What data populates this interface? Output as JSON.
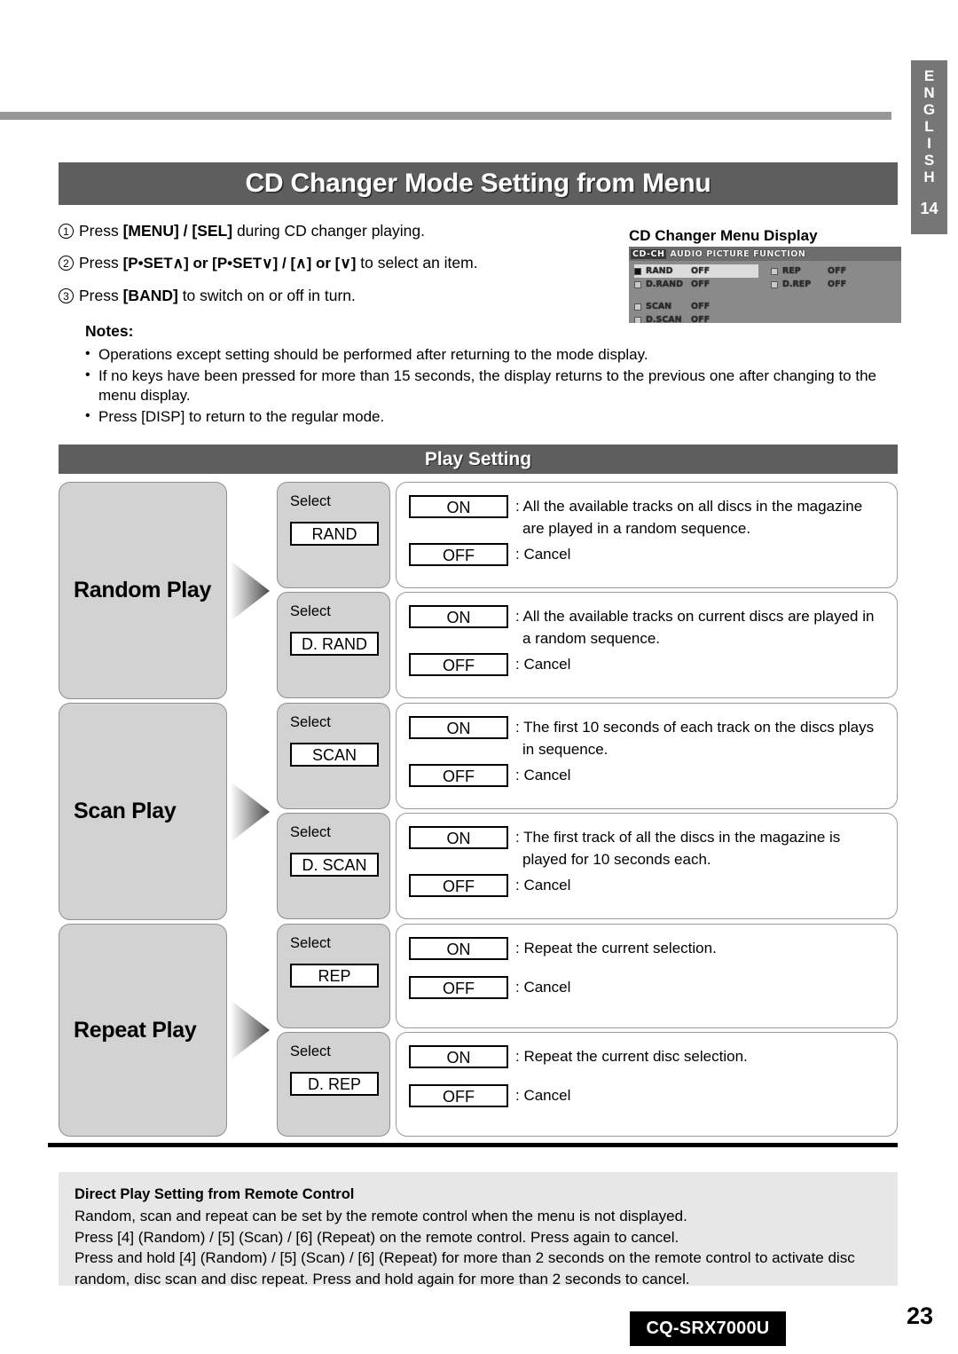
{
  "lang_tab": {
    "letters": [
      "E",
      "N",
      "G",
      "L",
      "I",
      "S",
      "H"
    ],
    "section_number": "14"
  },
  "header": {
    "title": "CD Changer Mode Setting from Menu"
  },
  "steps": [
    {
      "num": "1",
      "prefix": "Press ",
      "key1": "[MENU] / [SEL]",
      "suffix": " during CD changer playing."
    },
    {
      "num": "2",
      "prefix": "Press ",
      "key1": "[P•SET∧] or [P•SET∨] / [∧] or [∨]",
      "suffix": " to select an item."
    },
    {
      "num": "3",
      "prefix": "Press ",
      "key1": "[BAND]",
      "suffix": " to switch on or off in turn."
    }
  ],
  "notes": {
    "heading": "Notes:",
    "items": [
      "Operations except setting should be performed after returning to the mode display.",
      "If no keys have been pressed for more than 15 seconds, the display returns to the previous one after changing to the menu display.",
      "Press [DISP] to return to the regular mode."
    ]
  },
  "lcd": {
    "caption": "CD Changer Menu Display",
    "tabs": [
      "CD-CH",
      "AUDIO",
      "PICTURE",
      "FUNCTION"
    ],
    "selected_tab": "CD-CH",
    "left_items": [
      {
        "label": "RAND",
        "value": "OFF",
        "highlighted": true
      },
      {
        "label": "D.RAND",
        "value": "OFF",
        "highlighted": false
      }
    ],
    "right_items": [
      {
        "label": "REP",
        "value": "OFF",
        "highlighted": false
      },
      {
        "label": "D.REP",
        "value": "OFF",
        "highlighted": false
      }
    ],
    "bottom_items": [
      {
        "label": "SCAN",
        "value": "OFF",
        "highlighted": false
      },
      {
        "label": "D.SCAN",
        "value": "OFF",
        "highlighted": false
      }
    ]
  },
  "play_setting": {
    "title": "Play Setting"
  },
  "groups": [
    {
      "category": "Random Play",
      "rows": [
        {
          "select_label": "Select",
          "code": "RAND",
          "on_label": "ON",
          "on_desc": ": All the available tracks on all discs in the magazine",
          "on_desc_cont": "are played in a random sequence.",
          "off_label": "OFF",
          "off_desc": ": Cancel"
        },
        {
          "select_label": "Select",
          "code": "D. RAND",
          "on_label": "ON",
          "on_desc": ": All the available tracks on current discs are played in",
          "on_desc_cont": "a random sequence.",
          "off_label": "OFF",
          "off_desc": ": Cancel"
        }
      ]
    },
    {
      "category": "Scan Play",
      "rows": [
        {
          "select_label": "Select",
          "code": "SCAN",
          "on_label": "ON",
          "on_desc": ": The first 10 seconds of each track on the discs plays",
          "on_desc_cont": "in sequence.",
          "off_label": "OFF",
          "off_desc": ": Cancel"
        },
        {
          "select_label": "Select",
          "code": "D. SCAN",
          "on_label": "ON",
          "on_desc": ": The first track of all the discs in the magazine is",
          "on_desc_cont": "played for 10 seconds each.",
          "off_label": "OFF",
          "off_desc": ": Cancel"
        }
      ]
    },
    {
      "category": "Repeat Play",
      "rows": [
        {
          "select_label": "Select",
          "code": "REP",
          "on_label": "ON",
          "on_desc": ": Repeat the current selection.",
          "on_desc_cont": "",
          "off_label": "OFF",
          "off_desc": ": Cancel"
        },
        {
          "select_label": "Select",
          "code": "D. REP",
          "on_label": "ON",
          "on_desc": ": Repeat the current disc selection.",
          "on_desc_cont": "",
          "off_label": "OFF",
          "off_desc": ": Cancel"
        }
      ]
    }
  ],
  "direct_play": {
    "heading": "Direct Play Setting from Remote Control",
    "line1": "Random, scan and repeat can be set by the remote control when the menu is not displayed.",
    "line2": "Press [4] (Random) / [5] (Scan) / [6] (Repeat) on the remote control.  Press again to cancel.",
    "line3": "Press and hold [4] (Random) / [5] (Scan) / [6] (Repeat) for more than 2 seconds on the remote control to activate disc",
    "line4": "random, disc scan and disc repeat.  Press and hold again for more than 2 seconds to cancel."
  },
  "footer": {
    "model": "CQ-SRX7000U",
    "page_number": "23"
  }
}
